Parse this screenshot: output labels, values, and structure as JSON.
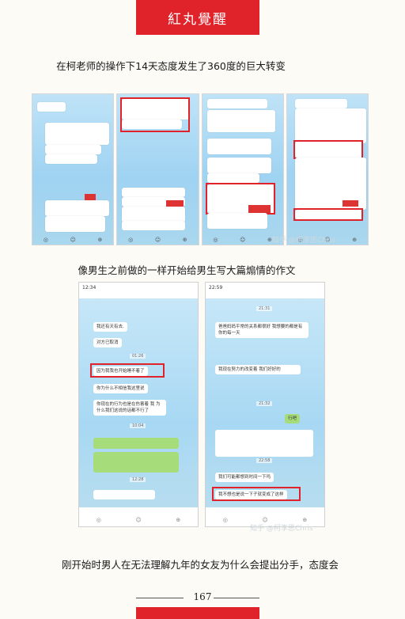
{
  "header": {
    "banner": "紅丸覺醒"
  },
  "headings": {
    "first": "在柯老师的操作下14天态度发生了360度的巨大转变",
    "second": "像男生之前做的一样开始给男生写大篇煽情的作文"
  },
  "paragraph": "刚开始时男人在无法理解九年的女友为什么会提出分手，态度会",
  "watermarks": {
    "top": "知乎 @柯李思Chris",
    "bottom": "知乎 @柯李思Chris"
  },
  "shot_left": {
    "time": "12:34",
    "messages": [
      "我还有天有去.",
      "对方已取消",
      "因为我我也开始睡不着了",
      "你为什么不相信我这里说",
      "你现在的行为也是在伤害着 我 为什么我们这说的话都不行了"
    ],
    "times": [
      "01:26",
      "10:04",
      "12:28"
    ]
  },
  "shot_right": {
    "time": "22:59",
    "messages": [
      "爸爸妈妈平常的关系都很好 我想要的都是有你的每一天",
      "我现在努力的改变着 我们好好的",
      "行吧",
      "我们可能都想到时间一下吗",
      "我不想也是说一下子就变成了这样"
    ],
    "times": [
      "21:31",
      "21:32",
      "22:58"
    ]
  },
  "page_number": "167"
}
